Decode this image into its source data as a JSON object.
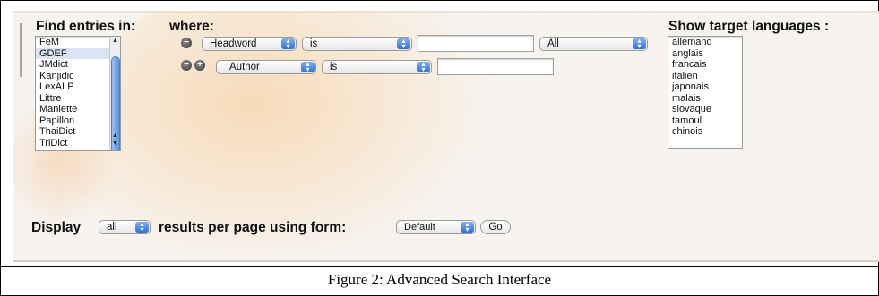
{
  "find_entries": {
    "label": "Find entries in:",
    "dictionaries": [
      "FeM",
      "GDEF",
      "JMdict",
      "Kanjidic",
      "LexALP",
      "Littre",
      "Maniette",
      "Papillon",
      "ThaiDict",
      "TriDict"
    ],
    "selected_index": 1
  },
  "where": {
    "label": "where:",
    "row1": {
      "field": "Headword",
      "operator": "is",
      "value": "",
      "scope": "All"
    },
    "row2": {
      "field": "Author",
      "operator": "is",
      "value": ""
    },
    "remove_icon": "−",
    "add_icon": "+"
  },
  "target_languages": {
    "label": "Show target languages :",
    "items": [
      "allemand",
      "anglais",
      "francais",
      "italien",
      "japonais",
      "malais",
      "slovaque",
      "tamoul",
      "chinois"
    ]
  },
  "display": {
    "prefix": "Display",
    "count": "all",
    "middle": "results per page using form:",
    "form": "Default",
    "go_label": "Go"
  },
  "caption": "Figure 2:  Advanced Search Interface",
  "icons": {
    "select_arrows": "chevron-up-down-icon",
    "remove": "minus-circle-icon",
    "add": "plus-circle-icon"
  }
}
